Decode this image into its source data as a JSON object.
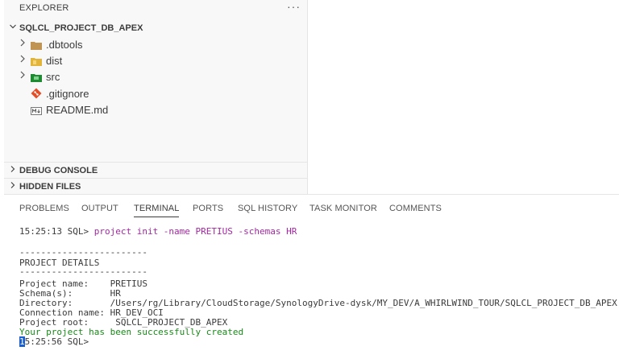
{
  "explorer": {
    "title": "EXPLORER",
    "more": "···",
    "project_name": "SQLCL_PROJECT_DB_APEX",
    "items": [
      {
        "label": ".dbtools",
        "kind": "folder",
        "color": "#c09553"
      },
      {
        "label": "dist",
        "kind": "folder",
        "color": "#e2b43a"
      },
      {
        "label": "src",
        "kind": "folder",
        "color": "#1e8a32"
      },
      {
        "label": ".gitignore",
        "kind": "git"
      },
      {
        "label": "README.md",
        "kind": "markdown"
      }
    ],
    "debug_console": "DEBUG CONSOLE",
    "hidden_files": "HIDDEN FILES"
  },
  "panel": {
    "tabs": [
      "PROBLEMS",
      "OUTPUT",
      "TERMINAL",
      "PORTS",
      "SQL HISTORY",
      "TASK MONITOR",
      "COMMENTS"
    ],
    "active_tab": "TERMINAL"
  },
  "terminal": {
    "prompt1": "15:25:13 SQL> ",
    "command": "project init -name PRETIUS -schemas HR",
    "rule": "------------------------",
    "details_header": "PROJECT DETAILS",
    "details": [
      "Project name:    PRETIUS",
      "Schema(s):       HR",
      "Directory:       /Users/rg/Library/CloudStorage/SynologyDrive-dysk/MY_DEV/A_WHIRLWIND_TOUR/SQLCL_PROJECT_DB_APEX",
      "Connection name: HR_DEV_OCI",
      "Project root:     SQLCL_PROJECT_DB_APEX"
    ],
    "success": "Your project has been successfully created",
    "prompt2_cursor_char": "1",
    "prompt2_rest": "5:25:56 SQL>"
  }
}
